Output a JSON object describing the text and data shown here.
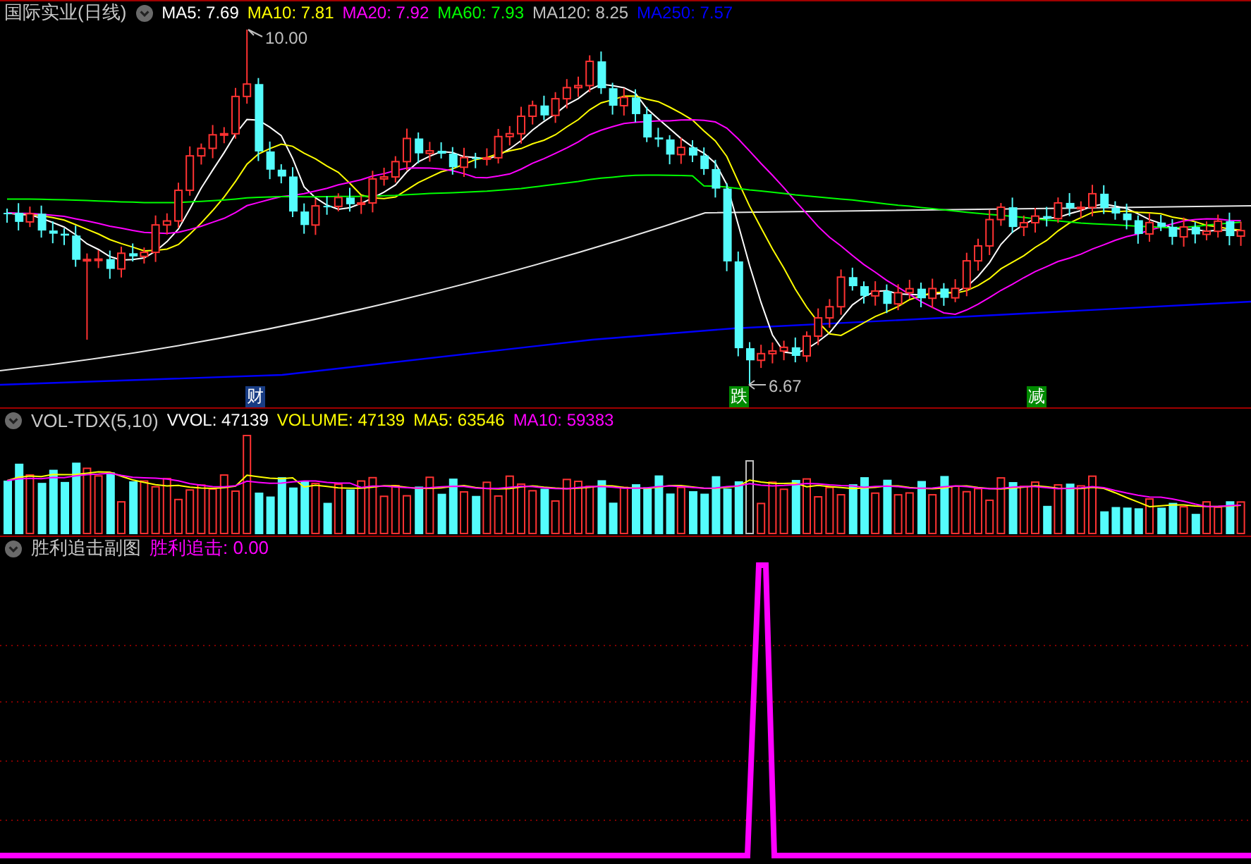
{
  "price_panel": {
    "title": "国际实业(日线)",
    "legend": [
      {
        "text": "MA5: 7.69",
        "color": "#ffffff"
      },
      {
        "text": "MA10: 7.81",
        "color": "#ffff00"
      },
      {
        "text": "MA20: 7.92",
        "color": "#ff00ff"
      },
      {
        "text": "MA60: 7.93",
        "color": "#00ff00"
      },
      {
        "text": "MA120: 8.25",
        "color": "#c0c0c0"
      },
      {
        "text": "MA250: 7.57",
        "color": "#0000ff"
      }
    ],
    "high_label": "10.00",
    "low_label": "6.67",
    "markers": [
      {
        "text": "财",
        "color": "#183c84"
      },
      {
        "text": "跌",
        "color": "#008a00"
      },
      {
        "text": "减",
        "color": "#008a00"
      }
    ]
  },
  "volume_panel": {
    "title": "VOL-TDX(5,10)",
    "legend": [
      {
        "text": "VVOL: 47139",
        "color": "#ffffff"
      },
      {
        "text": "VOLUME: 47139",
        "color": "#ffff00"
      },
      {
        "text": "MA5: 63546",
        "color": "#ffff00"
      },
      {
        "text": "MA10: 59383",
        "color": "#ff00ff"
      }
    ]
  },
  "indicator_panel": {
    "title": "胜利追击副图",
    "legend": [
      {
        "text": "胜利追击: 0.00",
        "color": "#ff00ff"
      }
    ]
  }
}
